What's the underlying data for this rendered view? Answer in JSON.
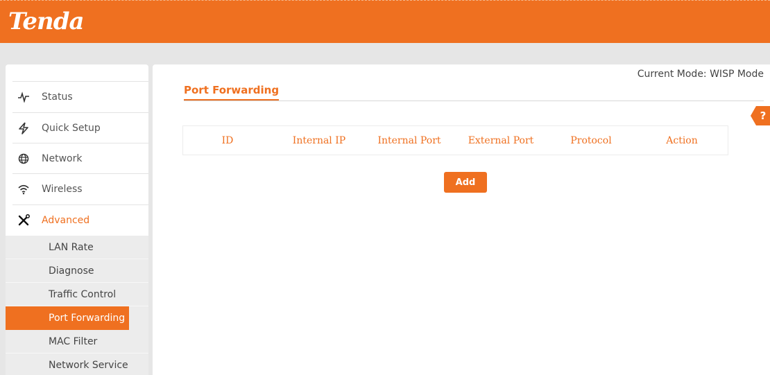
{
  "brand": {
    "logo_text": "Tenda",
    "accent": "#ef7020"
  },
  "header": {
    "mode_text": "Current Mode: WISP Mode"
  },
  "sidebar": {
    "items": [
      {
        "label": "Status",
        "icon": "pulse-icon"
      },
      {
        "label": "Quick Setup",
        "icon": "lightning-icon"
      },
      {
        "label": "Network",
        "icon": "globe-icon"
      },
      {
        "label": "Wireless",
        "icon": "wifi-icon"
      },
      {
        "label": "Advanced",
        "icon": "tools-icon",
        "active": true
      }
    ],
    "sub_items": [
      {
        "label": "LAN Rate"
      },
      {
        "label": "Diagnose"
      },
      {
        "label": "Traffic Control"
      },
      {
        "label": "Port Forwarding",
        "active": true
      },
      {
        "label": "MAC Filter"
      },
      {
        "label": "Network Service"
      }
    ]
  },
  "main": {
    "title": "Port Forwarding",
    "help_label": "?",
    "table": {
      "columns": [
        "ID",
        "Internal IP",
        "Internal Port",
        "External Port",
        "Protocol",
        "Action"
      ],
      "rows": []
    },
    "add_label": "Add"
  }
}
